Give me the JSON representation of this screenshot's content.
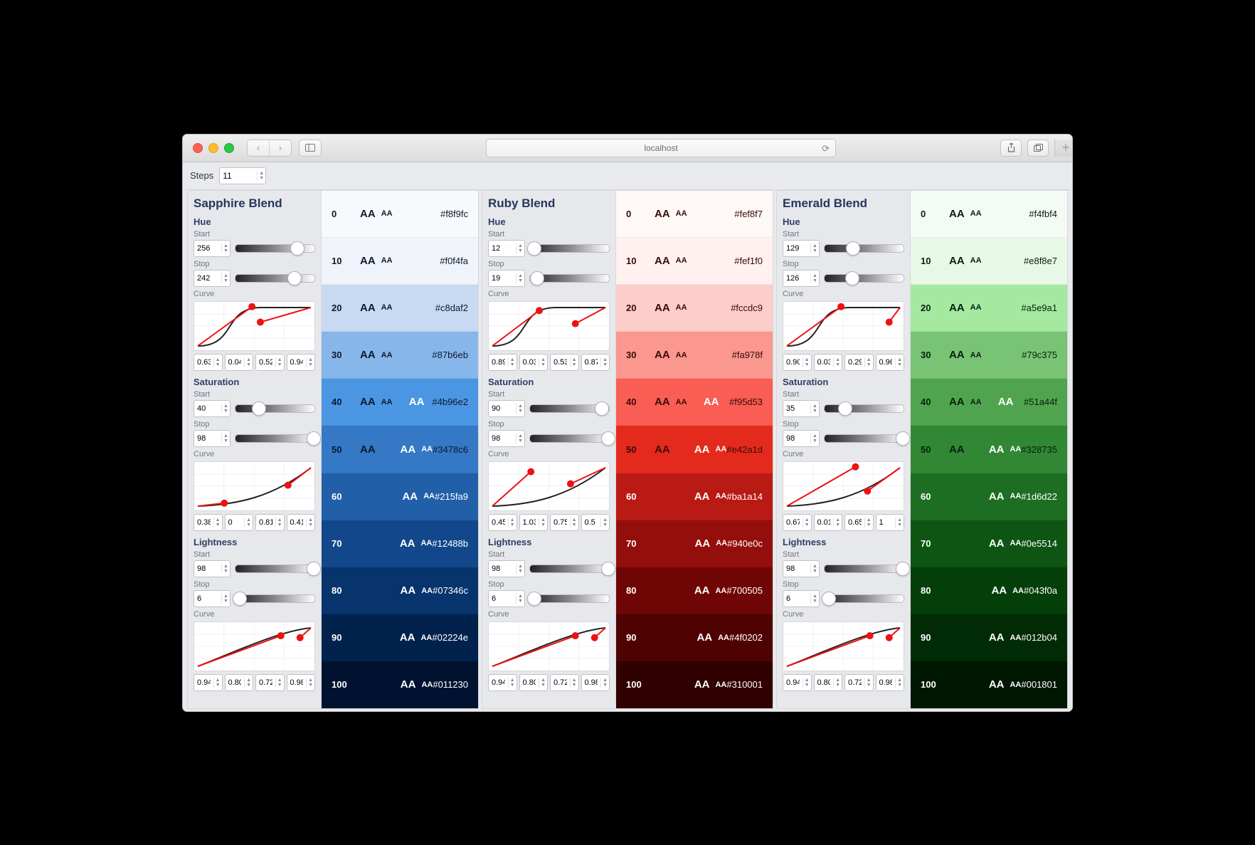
{
  "browser": {
    "url_text": "localhost"
  },
  "toolbar": {
    "steps_label": "Steps",
    "steps_value": "11"
  },
  "scales": [
    {
      "title": "Sapphire Blend",
      "hue": {
        "heading": "Hue",
        "start_label": "Start",
        "start": "256",
        "start_pct": 78,
        "stop_label": "Stop",
        "stop": "242",
        "stop_pct": 74,
        "curve_label": "Curve",
        "curve": [
          "0.636",
          "0.045",
          "0.522",
          "0.948"
        ],
        "curve_shape": "s",
        "handles": [
          [
            48,
            10
          ],
          [
            55,
            42
          ]
        ]
      },
      "saturation": {
        "heading": "Saturation",
        "start_label": "Start",
        "start": "40",
        "start_pct": 30,
        "stop_label": "Stop",
        "stop": "98",
        "stop_pct": 98,
        "curve_label": "Curve",
        "curve": [
          "0.388",
          "0",
          "0.811",
          "0.419"
        ],
        "curve_shape": "r",
        "handles": [
          [
            25,
            85
          ],
          [
            78,
            48
          ]
        ]
      },
      "lightness": {
        "heading": "Lightness",
        "start_label": "Start",
        "start": "98",
        "start_pct": 98,
        "stop_label": "Stop",
        "stop": "6",
        "stop_pct": 6,
        "curve_label": "Curve",
        "curve": [
          "0.945",
          "0.806",
          "0.721",
          "0.984"
        ],
        "curve_shape": "d",
        "handles": [
          [
            72,
            28
          ],
          [
            88,
            32
          ]
        ]
      },
      "swatches": [
        {
          "step": "0",
          "hex": "#f8f9fc",
          "bg": "#f8f9fc",
          "prim": "#0c1a2f",
          "primOn": true,
          "secA": "#0c1a2f",
          "secAOn": true,
          "secB": "#ffffff",
          "secBOn": false
        },
        {
          "step": "10",
          "hex": "#f0f4fa",
          "bg": "#f0f4fa",
          "prim": "#0c1a2f",
          "primOn": true,
          "secA": "#0c1a2f",
          "secAOn": true,
          "secB": "#ffffff",
          "secBOn": false
        },
        {
          "step": "20",
          "hex": "#c8daf2",
          "bg": "#c8daf2",
          "prim": "#0c1a2f",
          "primOn": true,
          "secA": "#0c1a2f",
          "secAOn": true,
          "secB": "#ffffff",
          "secBOn": false
        },
        {
          "step": "30",
          "hex": "#87b6eb",
          "bg": "#87b6eb",
          "prim": "#0c1a2f",
          "primOn": true,
          "secA": "#0c1a2f",
          "secAOn": true,
          "secB": "#ffffff",
          "secBOn": false
        },
        {
          "step": "40",
          "hex": "#4b96e2",
          "bg": "#4b96e2",
          "prim": "#0c1a2f",
          "primOn": true,
          "secA": "#0c1a2f",
          "secAOn": true,
          "secB": "#ffffff",
          "secBOn": true
        },
        {
          "step": "50",
          "hex": "#3478c6",
          "bg": "#3478c6",
          "prim": "#0c1a2f",
          "primOn": true,
          "secA": "#ffffff",
          "secAOn": true,
          "secB": "#ffffff",
          "secBOn": true
        },
        {
          "step": "60",
          "hex": "#215fa9",
          "bg": "#215fa9",
          "prim": "#ffffff",
          "primOn": false,
          "secA": "#ffffff",
          "secAOn": true,
          "secB": "#ffffff",
          "secBOn": true
        },
        {
          "step": "70",
          "hex": "#12488b",
          "bg": "#12488b",
          "prim": "#ffffff",
          "primOn": false,
          "secA": "#ffffff",
          "secAOn": true,
          "secB": "#ffffff",
          "secBOn": true
        },
        {
          "step": "80",
          "hex": "#07346c",
          "bg": "#07346c",
          "prim": "#ffffff",
          "primOn": false,
          "secA": "#ffffff",
          "secAOn": true,
          "secB": "#ffffff",
          "secBOn": true
        },
        {
          "step": "90",
          "hex": "#02224e",
          "bg": "#02224e",
          "prim": "#ffffff",
          "primOn": false,
          "secA": "#ffffff",
          "secAOn": true,
          "secB": "#ffffff",
          "secBOn": true
        },
        {
          "step": "100",
          "hex": "#011230",
          "bg": "#011230",
          "prim": "#ffffff",
          "primOn": false,
          "secA": "#ffffff",
          "secAOn": true,
          "secB": "#ffffff",
          "secBOn": true
        }
      ]
    },
    {
      "title": "Ruby Blend",
      "hue": {
        "heading": "Hue",
        "start_label": "Start",
        "start": "12",
        "start_pct": 6,
        "stop_label": "Stop",
        "stop": "19",
        "stop_pct": 10,
        "curve_label": "Curve",
        "curve": [
          "0.891",
          "0.03",
          "0.537",
          "0.871"
        ],
        "curve_shape": "s",
        "handles": [
          [
            42,
            18
          ],
          [
            72,
            45
          ]
        ]
      },
      "saturation": {
        "heading": "Saturation",
        "start_label": "Start",
        "start": "90",
        "start_pct": 90,
        "stop_label": "Stop",
        "stop": "98",
        "stop_pct": 98,
        "curve_label": "Curve",
        "curve": [
          "0.45",
          "1.03",
          "0.75",
          "0.5"
        ],
        "curve_shape": "r",
        "handles": [
          [
            35,
            20
          ],
          [
            68,
            45
          ]
        ]
      },
      "lightness": {
        "heading": "Lightness",
        "start_label": "Start",
        "start": "98",
        "start_pct": 98,
        "stop_label": "Stop",
        "stop": "6",
        "stop_pct": 6,
        "curve_label": "Curve",
        "curve": [
          "0.945",
          "0.806",
          "0.721",
          "0.984"
        ],
        "curve_shape": "d",
        "handles": [
          [
            72,
            28
          ],
          [
            88,
            32
          ]
        ]
      },
      "swatches": [
        {
          "step": "0",
          "hex": "#fef8f7",
          "bg": "#fef8f7",
          "prim": "#3a0a06",
          "primOn": true,
          "secA": "#3a0a06",
          "secAOn": true,
          "secB": "#ffffff",
          "secBOn": false
        },
        {
          "step": "10",
          "hex": "#fef1f0",
          "bg": "#fef1f0",
          "prim": "#3a0a06",
          "primOn": true,
          "secA": "#3a0a06",
          "secAOn": true,
          "secB": "#ffffff",
          "secBOn": false
        },
        {
          "step": "20",
          "hex": "#fccdc9",
          "bg": "#fccdc9",
          "prim": "#3a0a06",
          "primOn": true,
          "secA": "#3a0a06",
          "secAOn": true,
          "secB": "#ffffff",
          "secBOn": false
        },
        {
          "step": "30",
          "hex": "#fa978f",
          "bg": "#fa978f",
          "prim": "#3a0a06",
          "primOn": true,
          "secA": "#3a0a06",
          "secAOn": true,
          "secB": "#ffffff",
          "secBOn": false
        },
        {
          "step": "40",
          "hex": "#f95d53",
          "bg": "#f95d53",
          "prim": "#3a0a06",
          "primOn": true,
          "secA": "#3a0a06",
          "secAOn": true,
          "secB": "#ffffff",
          "secBOn": true
        },
        {
          "step": "50",
          "hex": "#e42a1d",
          "bg": "#e42a1d",
          "prim": "#3a0a06",
          "primOn": true,
          "secA": "#ffffff",
          "secAOn": true,
          "secB": "#ffffff",
          "secBOn": true
        },
        {
          "step": "60",
          "hex": "#ba1a14",
          "bg": "#ba1a14",
          "prim": "#ffffff",
          "primOn": false,
          "secA": "#ffffff",
          "secAOn": true,
          "secB": "#ffffff",
          "secBOn": true
        },
        {
          "step": "70",
          "hex": "#940e0c",
          "bg": "#940e0c",
          "prim": "#ffffff",
          "primOn": false,
          "secA": "#ffffff",
          "secAOn": true,
          "secB": "#ffffff",
          "secBOn": true
        },
        {
          "step": "80",
          "hex": "#700505",
          "bg": "#700505",
          "prim": "#ffffff",
          "primOn": false,
          "secA": "#ffffff",
          "secAOn": true,
          "secB": "#ffffff",
          "secBOn": true
        },
        {
          "step": "90",
          "hex": "#4f0202",
          "bg": "#4f0202",
          "prim": "#ffffff",
          "primOn": false,
          "secA": "#ffffff",
          "secAOn": true,
          "secB": "#ffffff",
          "secBOn": true
        },
        {
          "step": "100",
          "hex": "#310001",
          "bg": "#310001",
          "prim": "#ffffff",
          "primOn": false,
          "secA": "#ffffff",
          "secAOn": true,
          "secB": "#ffffff",
          "secBOn": true
        }
      ]
    },
    {
      "title": "Emerald Blend",
      "hue": {
        "heading": "Hue",
        "start_label": "Start",
        "start": "129",
        "start_pct": 36,
        "stop_label": "Stop",
        "stop": "126",
        "stop_pct": 35,
        "curve_label": "Curve",
        "curve": [
          "0.905",
          "0.032",
          "0.294",
          "0.968"
        ],
        "curve_shape": "s",
        "handles": [
          [
            48,
            10
          ],
          [
            88,
            42
          ]
        ]
      },
      "saturation": {
        "heading": "Saturation",
        "start_label": "Start",
        "start": "35",
        "start_pct": 27,
        "stop_label": "Stop",
        "stop": "98",
        "stop_pct": 98,
        "curve_label": "Curve",
        "curve": [
          "0.677",
          "0.016",
          "0.652",
          "1"
        ],
        "curve_shape": "r",
        "handles": [
          [
            60,
            10
          ],
          [
            70,
            60
          ]
        ]
      },
      "lightness": {
        "heading": "Lightness",
        "start_label": "Start",
        "start": "98",
        "start_pct": 98,
        "stop_label": "Stop",
        "stop": "6",
        "stop_pct": 6,
        "curve_label": "Curve",
        "curve": [
          "0.945",
          "0.806",
          "0.721",
          "0.984"
        ],
        "curve_shape": "d",
        "handles": [
          [
            72,
            28
          ],
          [
            88,
            32
          ]
        ]
      },
      "swatches": [
        {
          "step": "0",
          "hex": "#f4fbf4",
          "bg": "#f4fbf4",
          "prim": "#06200c",
          "primOn": true,
          "secA": "#06200c",
          "secAOn": true,
          "secB": "#ffffff",
          "secBOn": false
        },
        {
          "step": "10",
          "hex": "#e8f8e7",
          "bg": "#e8f8e7",
          "prim": "#06200c",
          "primOn": true,
          "secA": "#06200c",
          "secAOn": true,
          "secB": "#ffffff",
          "secBOn": false
        },
        {
          "step": "20",
          "hex": "#a5e9a1",
          "bg": "#a5e9a1",
          "prim": "#06200c",
          "primOn": true,
          "secA": "#06200c",
          "secAOn": true,
          "secB": "#ffffff",
          "secBOn": false
        },
        {
          "step": "30",
          "hex": "#79c375",
          "bg": "#79c375",
          "prim": "#06200c",
          "primOn": true,
          "secA": "#06200c",
          "secAOn": true,
          "secB": "#ffffff",
          "secBOn": false
        },
        {
          "step": "40",
          "hex": "#51a44f",
          "bg": "#51a44f",
          "prim": "#06200c",
          "primOn": true,
          "secA": "#06200c",
          "secAOn": true,
          "secB": "#ffffff",
          "secBOn": true
        },
        {
          "step": "50",
          "hex": "#328735",
          "bg": "#328735",
          "prim": "#06200c",
          "primOn": true,
          "secA": "#ffffff",
          "secAOn": true,
          "secB": "#ffffff",
          "secBOn": true
        },
        {
          "step": "60",
          "hex": "#1d6d22",
          "bg": "#1d6d22",
          "prim": "#ffffff",
          "primOn": false,
          "secA": "#ffffff",
          "secAOn": true,
          "secB": "#ffffff",
          "secBOn": true
        },
        {
          "step": "70",
          "hex": "#0e5514",
          "bg": "#0e5514",
          "prim": "#ffffff",
          "primOn": false,
          "secA": "#ffffff",
          "secAOn": true,
          "secB": "#ffffff",
          "secBOn": true
        },
        {
          "step": "80",
          "hex": "#043f0a",
          "bg": "#043f0a",
          "prim": "#ffffff",
          "primOn": false,
          "secA": "#ffffff",
          "secAOn": true,
          "secB": "#ffffff",
          "secBOn": true
        },
        {
          "step": "90",
          "hex": "#012b04",
          "bg": "#012b04",
          "prim": "#ffffff",
          "primOn": false,
          "secA": "#ffffff",
          "secAOn": true,
          "secB": "#ffffff",
          "secBOn": true
        },
        {
          "step": "100",
          "hex": "#001801",
          "bg": "#001801",
          "prim": "#ffffff",
          "primOn": false,
          "secA": "#ffffff",
          "secAOn": true,
          "secB": "#ffffff",
          "secBOn": true
        }
      ]
    }
  ]
}
